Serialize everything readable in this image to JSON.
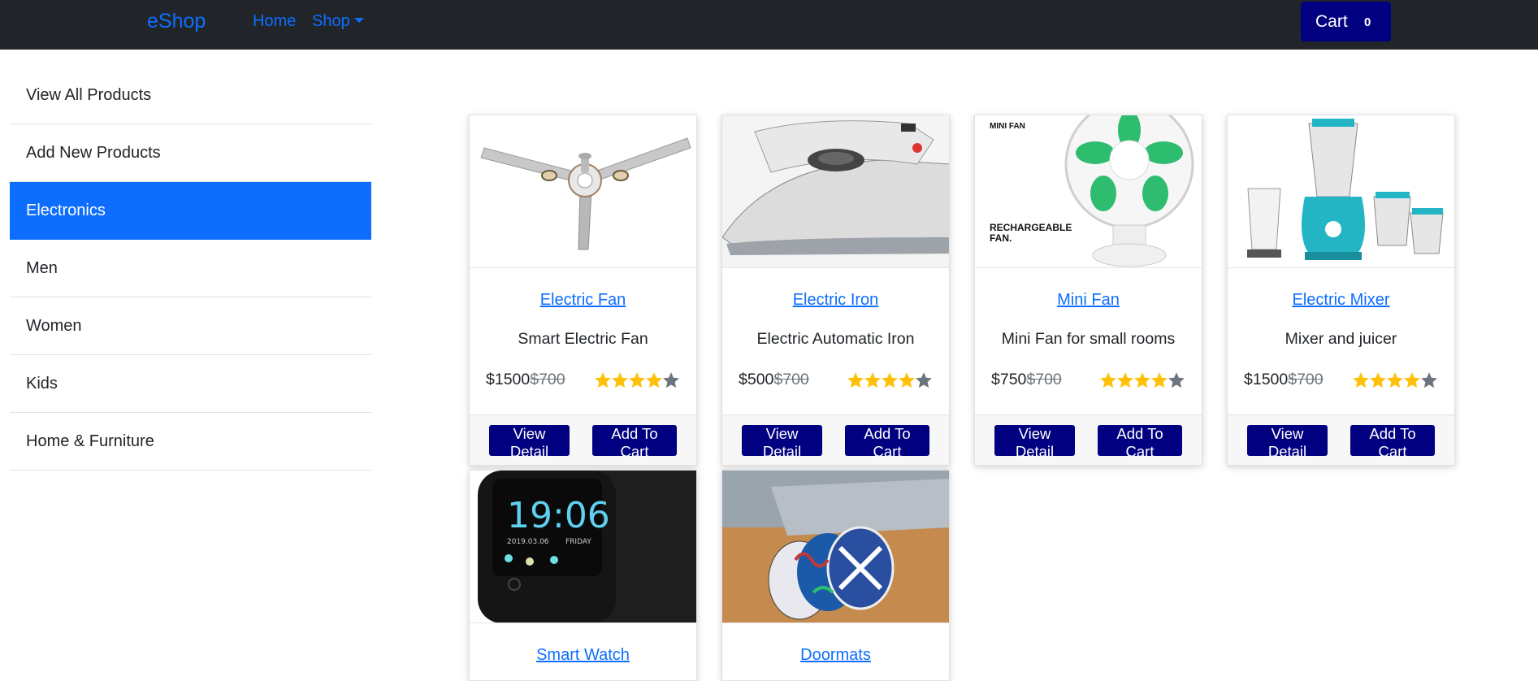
{
  "navbar": {
    "brand": "eShop",
    "links": [
      "Home",
      "Shop"
    ],
    "cart_label": "Cart",
    "cart_count": "0"
  },
  "sidebar": {
    "items": [
      {
        "label": "View All Products",
        "active": false
      },
      {
        "label": "Add New Products",
        "active": false
      },
      {
        "label": "Electronics",
        "active": true
      },
      {
        "label": "Men",
        "active": false
      },
      {
        "label": "Women",
        "active": false
      },
      {
        "label": "Kids",
        "active": false
      },
      {
        "label": "Home & Furniture",
        "active": false
      }
    ]
  },
  "colors": {
    "navbar_bg": "#212529",
    "link": "#0d6efd",
    "button": "#000080",
    "active_item": "#0d6efd",
    "star_filled": "#ffc107",
    "star_empty": "#6c757d"
  },
  "products": [
    {
      "title": "Electric Fan",
      "description": "Smart Electric Fan",
      "price": "$1500",
      "old_price": "$700",
      "rating": 4,
      "image": "ceiling-fan-image",
      "view_label": "View Detail",
      "cart_label": "Add To Cart"
    },
    {
      "title": "Electric Iron",
      "description": "Electric Automatic Iron",
      "price": "$500",
      "old_price": "$700",
      "rating": 4,
      "image": "iron-image",
      "view_label": "View Detail",
      "cart_label": "Add To Cart"
    },
    {
      "title": "Mini Fan",
      "description": "Mini Fan for small rooms",
      "price": "$750",
      "old_price": "$700",
      "rating": 4,
      "image": "mini-fan-image",
      "image_text": [
        "MINI FAN",
        "RECHARGEABLE",
        "FAN."
      ],
      "view_label": "View Detail",
      "cart_label": "Add To Cart"
    },
    {
      "title": "Electric Mixer",
      "description": "Mixer and juicer",
      "price": "$1500",
      "old_price": "$700",
      "rating": 4,
      "image": "mixer-image",
      "view_label": "View Detail",
      "cart_label": "Add To Cart"
    },
    {
      "title": "Smart Watch",
      "image": "smart-watch-image",
      "image_text": [
        "19:06",
        "2019.03.06",
        "FRIDAY"
      ]
    },
    {
      "title": "Doormats",
      "image": "doormats-image"
    }
  ]
}
